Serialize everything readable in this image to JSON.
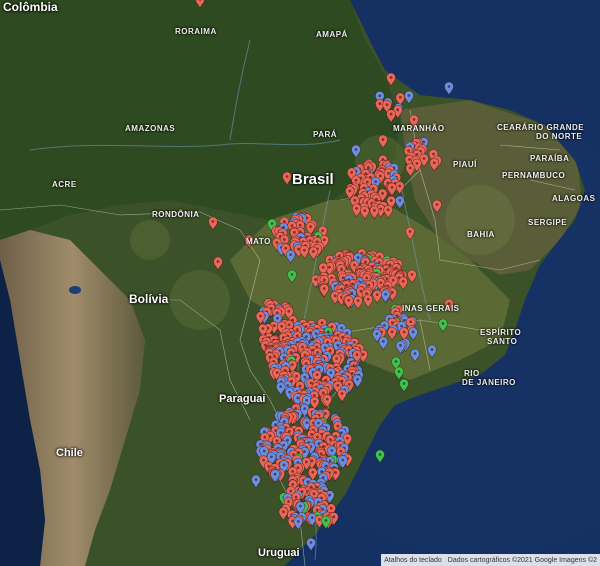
{
  "map": {
    "countries": {
      "colombia": "Colômbia",
      "brasil": "Brasil",
      "bolivia": "Bolívia",
      "paraguai": "Paraguai",
      "chile": "Chile",
      "uruguai": "Uruguai"
    },
    "states": {
      "roraima": "RORAIMA",
      "amapa": "AMAPÁ",
      "amazonas": "AMAZONAS",
      "para": "PARÁ",
      "maranhao": "MARANHÃO",
      "ceara": "CEARÁ",
      "rio_grande_do_norte_1": "RIO GRANDE",
      "rio_grande_do_norte_2": "DO NORTE",
      "paraiba": "PARAÍBA",
      "piaui": "PIAUÍ",
      "pernambuco": "PERNAMBUCO",
      "alagoas": "ALAGOAS",
      "sergipe": "SERGIPE",
      "acre": "ACRE",
      "rondonia": "RONDÔNIA",
      "mato_grosso": "MATO",
      "bahia": "BAHIA",
      "minas_gerais": "INAS GERAIS",
      "espirito_santo_1": "ESPÍRITO",
      "espirito_santo_2": "SANTO",
      "rio_de_janeiro_1": "RIO",
      "rio_de_janeiro_2": "DE JANEIRO"
    },
    "attribution": {
      "shortcuts": "Atalhos do teclado",
      "data": "Dados cartográficos ©2021 Google Imagens ©2"
    },
    "colors": {
      "ocean": "#10284f",
      "forest": "#2f4a22",
      "dry": "#6b6a45",
      "andes": "#8a7a5c",
      "pin_red": "#e8685a",
      "pin_blue": "#6b8fe0",
      "pin_green": "#3ec44e"
    },
    "icons": {
      "marker": "map-pin-icon"
    }
  }
}
